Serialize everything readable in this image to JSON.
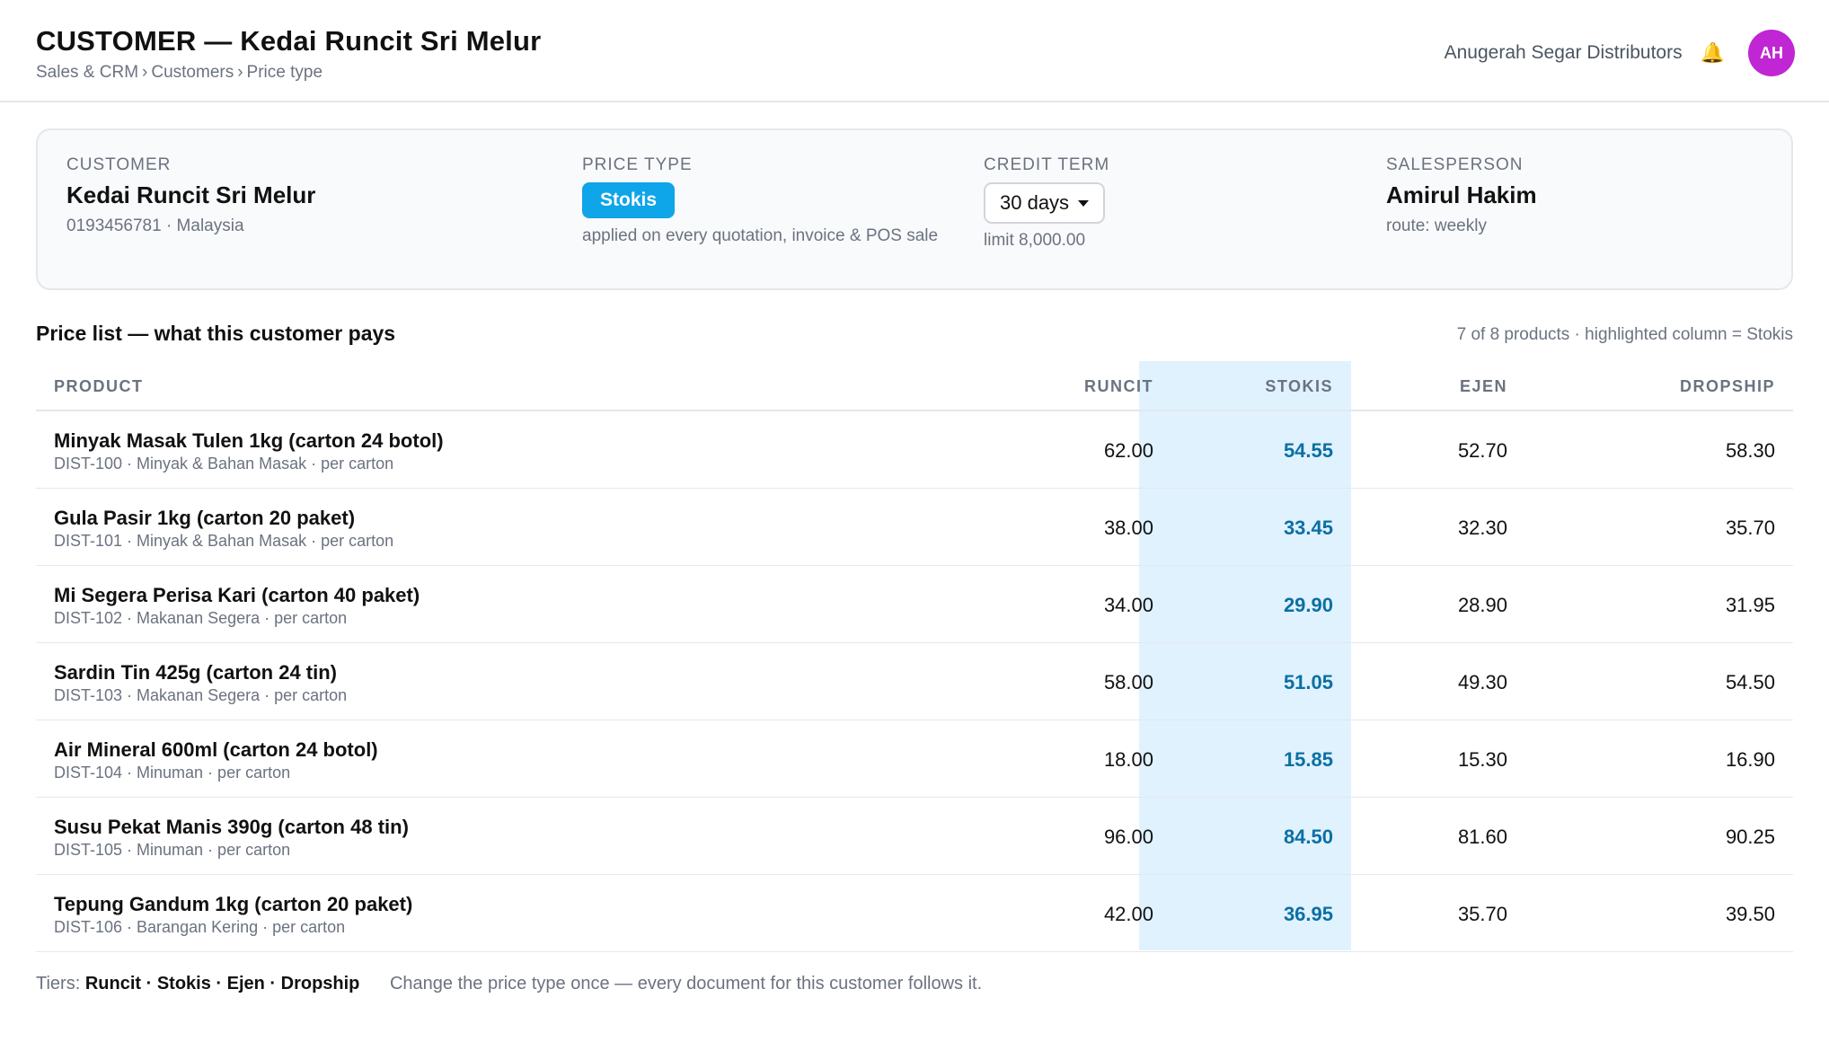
{
  "header": {
    "title": "CUSTOMER — Kedai Runcit Sri Melur",
    "breadcrumb": [
      "Sales & CRM",
      "Customers",
      "Price type"
    ],
    "breadcrumb_separator": "›",
    "company": "Anugerah Segar Distributors",
    "notification_icon": "bell-icon",
    "avatar_initials": "AH"
  },
  "customer_card": {
    "customer": {
      "label": "CUSTOMER",
      "name": "Kedai Runcit Sri Melur",
      "sub": "0193456781 · Malaysia"
    },
    "price_type": {
      "label": "PRICE TYPE",
      "value": "Stokis",
      "note": "applied on every quotation, invoice & POS sale"
    },
    "credit_term": {
      "label": "CREDIT TERM",
      "selected": "30 days",
      "limit": "limit 8,000.00"
    },
    "salesperson": {
      "label": "SALESPERSON",
      "name": "Amirul Hakim",
      "sub": "route: weekly"
    }
  },
  "price_list": {
    "title": "Price list — what this customer pays",
    "meta": "7 of 8 products · highlighted column = Stokis",
    "highlighted_column": "Stokis",
    "columns": [
      "PRODUCT",
      "RUNCIT",
      "STOKIS",
      "EJEN",
      "DROPSHIP"
    ],
    "rows": [
      {
        "name": "Minyak Masak Tulen 1kg (carton 24 botol)",
        "meta": "DIST-100 · Minyak & Bahan Masak · per carton",
        "runcit": "62.00",
        "stokis": "54.55",
        "ejen": "52.70",
        "dropship": "58.30"
      },
      {
        "name": "Gula Pasir 1kg (carton 20 paket)",
        "meta": "DIST-101 · Minyak & Bahan Masak · per carton",
        "runcit": "38.00",
        "stokis": "33.45",
        "ejen": "32.30",
        "dropship": "35.70"
      },
      {
        "name": "Mi Segera Perisa Kari (carton 40 paket)",
        "meta": "DIST-102 · Makanan Segera · per carton",
        "runcit": "34.00",
        "stokis": "29.90",
        "ejen": "28.90",
        "dropship": "31.95"
      },
      {
        "name": "Sardin Tin 425g (carton 24 tin)",
        "meta": "DIST-103 · Makanan Segera · per carton",
        "runcit": "58.00",
        "stokis": "51.05",
        "ejen": "49.30",
        "dropship": "54.50"
      },
      {
        "name": "Air Mineral 600ml (carton 24 botol)",
        "meta": "DIST-104 · Minuman · per carton",
        "runcit": "18.00",
        "stokis": "15.85",
        "ejen": "15.30",
        "dropship": "16.90"
      },
      {
        "name": "Susu Pekat Manis 390g (carton 48 tin)",
        "meta": "DIST-105 · Minuman · per carton",
        "runcit": "96.00",
        "stokis": "84.50",
        "ejen": "81.60",
        "dropship": "90.25"
      },
      {
        "name": "Tepung Gandum 1kg (carton 20 paket)",
        "meta": "DIST-106 · Barangan Kering · per carton",
        "runcit": "42.00",
        "stokis": "36.95",
        "ejen": "35.70",
        "dropship": "39.50"
      }
    ]
  },
  "footer": {
    "tiers_label": "Tiers:",
    "tiers": "Runcit · Stokis · Ejen · Dropship",
    "note": "Change the price type once — every document for this customer follows it."
  },
  "colors": {
    "accent": "#0ea5e9",
    "highlight_band": "#e0f2fe",
    "highlight_text": "#0b6fa4",
    "avatar": "#c026d3"
  }
}
